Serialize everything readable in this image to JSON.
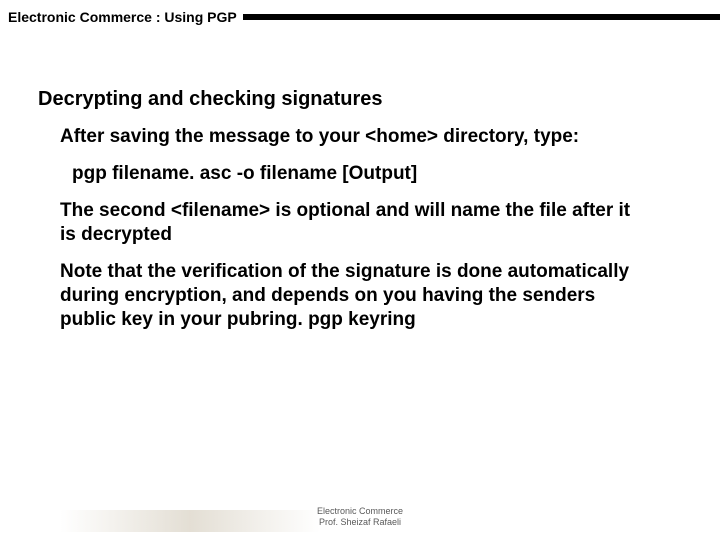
{
  "header": {
    "breadcrumb": "Electronic Commerce :  Using PGP"
  },
  "slide": {
    "heading": "Decrypting and checking signatures",
    "p1": "After saving the message to your <home> directory, type:",
    "cmd": "pgp filename. asc -o filename  [Output]",
    "p2": "The second <filename> is optional and will name the file after it is decrypted",
    "p3": "Note that the verification of the signature is done automatically during encryption, and depends on you having the senders public key in your pubring. pgp keyring"
  },
  "footer": {
    "line1": "Electronic Commerce",
    "line2": "Prof. Sheizaf Rafaeli"
  }
}
